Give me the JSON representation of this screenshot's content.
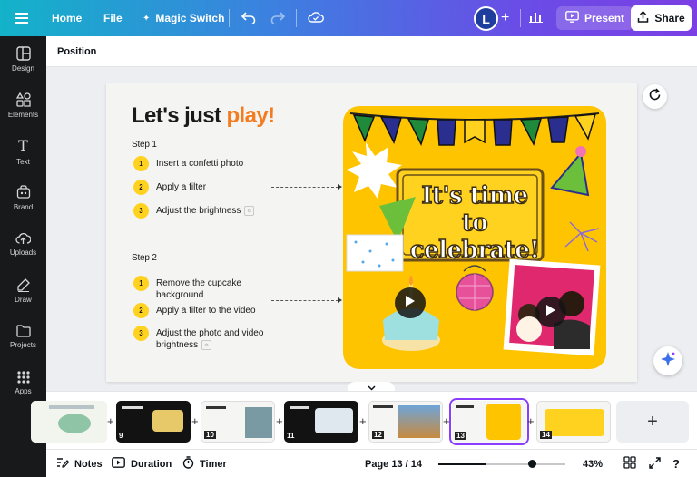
{
  "topbar": {
    "home": "Home",
    "file": "File",
    "magic_switch": "Magic Switch",
    "avatar_initial": "L",
    "present": "Present",
    "share": "Share"
  },
  "sidebar": {
    "items": [
      {
        "label": "Design",
        "icon": "design-icon"
      },
      {
        "label": "Elements",
        "icon": "elements-icon"
      },
      {
        "label": "Text",
        "icon": "text-icon"
      },
      {
        "label": "Brand",
        "icon": "brand-icon"
      },
      {
        "label": "Uploads",
        "icon": "uploads-icon"
      },
      {
        "label": "Draw",
        "icon": "draw-icon"
      },
      {
        "label": "Projects",
        "icon": "projects-icon"
      },
      {
        "label": "Apps",
        "icon": "apps-icon"
      }
    ]
  },
  "header": {
    "title": "Position"
  },
  "slide": {
    "title_main": "Let's just ",
    "title_accent": "play!",
    "step1": {
      "heading": "Step 1",
      "items": [
        {
          "num": "1",
          "text": "Insert a confetti photo"
        },
        {
          "num": "2",
          "text": "Apply a filter"
        },
        {
          "num": "3",
          "text": "Adjust the brightness"
        }
      ]
    },
    "step2": {
      "heading": "Step 2",
      "items": [
        {
          "num": "1",
          "text": "Remove the cupcake background"
        },
        {
          "num": "2",
          "text": "Apply a filter to the video"
        },
        {
          "num": "3",
          "text": "Adjust the  photo and video brightness"
        }
      ]
    },
    "banner_line1": "It's time to",
    "banner_line2": "celebrate!",
    "colors": {
      "accent": "#f47c20",
      "yellow": "#ffc400",
      "badge": "#ffd21f"
    }
  },
  "filmstrip": {
    "pages": [
      {
        "num": "",
        "theme": "light"
      },
      {
        "num": "9",
        "theme": "dark"
      },
      {
        "num": "10",
        "theme": "light"
      },
      {
        "num": "11",
        "theme": "dark"
      },
      {
        "num": "12",
        "theme": "light"
      },
      {
        "num": "13",
        "theme": "light",
        "selected": true
      },
      {
        "num": "14",
        "theme": "yellow"
      }
    ],
    "add_label": "+"
  },
  "bottombar": {
    "notes": "Notes",
    "duration": "Duration",
    "timer": "Timer",
    "page_indicator": "Page 13 / 14",
    "zoom": "43%",
    "zoom_fraction": 0.38
  }
}
